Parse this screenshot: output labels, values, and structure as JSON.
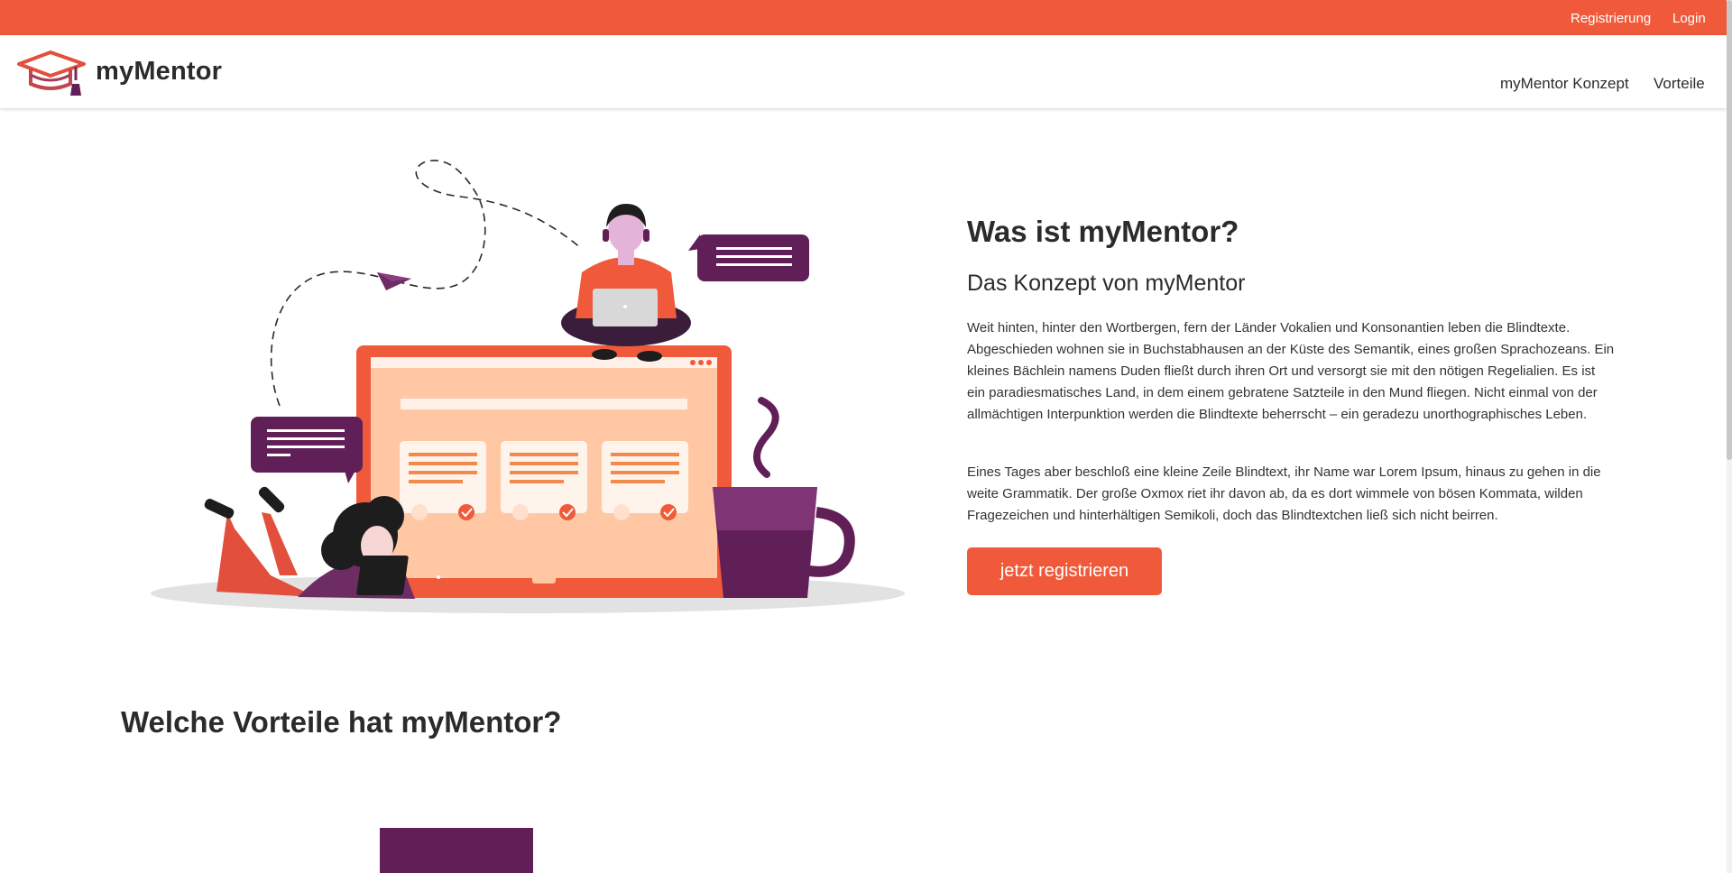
{
  "colors": {
    "accent": "#f05a3a",
    "purple": "#611f57",
    "text": "#2b2b2b",
    "peach": "#ffc7a3"
  },
  "topbar": {
    "register": "Registrierung",
    "login": "Login"
  },
  "header": {
    "logo_icon": "graduation-cap-icon",
    "logo_text": "myMentor",
    "nav": [
      "myMentor Konzept",
      "Vorteile"
    ]
  },
  "hero": {
    "title": "Was ist myMentor?",
    "subtitle": "Das Konzept von myMentor",
    "paragraph1": "Weit hinten, hinter den Wortbergen, fern der Länder Vokalien und Konsonantien leben die Blindtexte. Abgeschieden wohnen sie in Buchstabhausen an der Küste des Semantik, eines großen Sprachozeans. Ein kleines Bächlein namens Duden fließt durch ihren Ort und versorgt sie mit den nötigen Regelialien. Es ist ein paradiesmatisches Land, in dem einem gebratene Satzteile in den Mund fliegen. Nicht einmal von der allmächtigen Interpunktion werden die Blindtexte beherrscht – ein geradezu unorthographisches Leben.",
    "paragraph2": "Eines Tages aber beschloß eine kleine Zeile Blindtext, ihr Name war Lorem Ipsum, hinaus zu gehen in die weite Grammatik. Der große Oxmox riet ihr davon ab, da es dort wimmele von bösen Kommata, wilden Fragezeichen und hinterhältigen Semikoli, doch das Blindtextchen ließ sich nicht beirren.",
    "cta": "jetzt registrieren"
  },
  "advantages": {
    "title": "Welche Vorteile hat myMentor?"
  }
}
